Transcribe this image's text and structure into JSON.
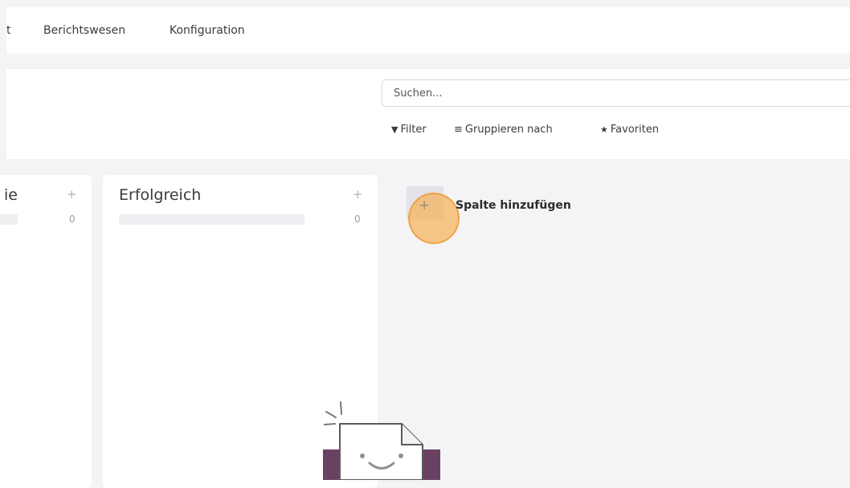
{
  "topnav": {
    "items": [
      "t",
      "Berichtswesen",
      "Konfiguration"
    ]
  },
  "search": {
    "placeholder": "Suchen..."
  },
  "controls": {
    "filter": "Filter",
    "group_by": "Gruppieren nach",
    "favorites": "Favoriten",
    "icons": [
      "filter-icon",
      "list-icon",
      "star-icon"
    ]
  },
  "kanban": {
    "columns": [
      {
        "title": "ie",
        "count": "0",
        "plus": "+"
      },
      {
        "title": "Erfolgreich",
        "count": "0",
        "plus": "+"
      }
    ],
    "add_column": {
      "plus": "+",
      "label": "Spalte hinzufügen"
    }
  },
  "colors": {
    "background": "#f4f4f7",
    "panel": "#ffffff",
    "highlight": "#f4b152",
    "illustration_purple": "#6b4163"
  }
}
